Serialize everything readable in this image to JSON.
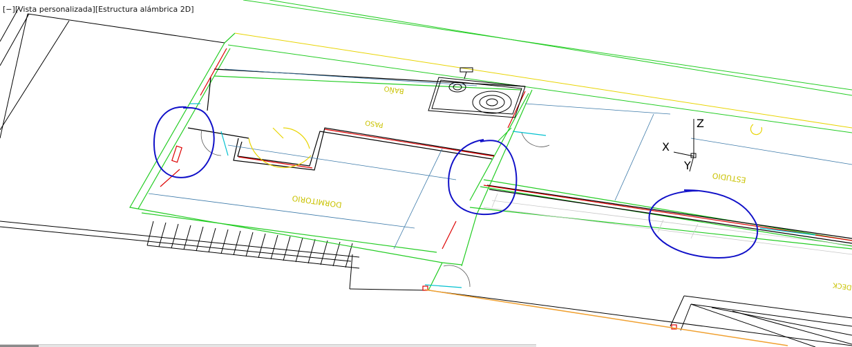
{
  "viewport": {
    "menu_bracket": "[−]",
    "view_name": "[Vista personalizada]",
    "visual_style": "[Estructura alámbrica 2D]"
  },
  "room_labels": {
    "bano": "BAÑO",
    "paso": "PASO",
    "dormitorio": "DORMITORIO",
    "estudio": "ESTUDIO",
    "deck": "DECK"
  },
  "ucs_icon": {
    "x_label": "X",
    "y_label": "Y",
    "z_label": "Z"
  },
  "colors": {
    "wall_green": "#22cc22",
    "dim_blue": "#3a78a8",
    "yellow": "#e8d400",
    "red": "#dd0000",
    "cyan": "#00c0d0",
    "orange": "#f0a030",
    "markup_blue": "#1010c8",
    "line_black": "#000000"
  }
}
